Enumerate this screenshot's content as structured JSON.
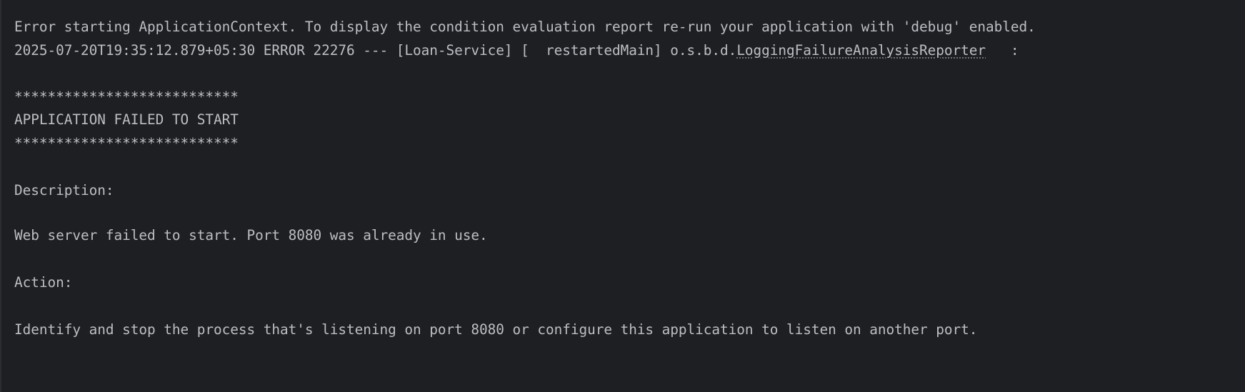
{
  "console": {
    "line1": "Error starting ApplicationContext. To display the condition evaluation report re-run your application with 'debug' enabled.",
    "line2_prefix": "2025-07-20T19:35:12.879+05:30 ERROR 22276 --- [Loan-Service] [  restartedMain] o.s.b.d.",
    "line2_link": "LoggingFailureAnalysisReporter",
    "line2_suffix": "   :",
    "stars_top": "***************************",
    "failed_title": "APPLICATION FAILED TO START",
    "stars_bottom": "***************************",
    "description_label": "Description:",
    "description_text": "Web server failed to start. Port 8080 was already in use.",
    "action_label": "Action:",
    "action_text": "Identify and stop the process that's listening on port 8080 or configure this application to listen on another port."
  },
  "colors": {
    "background": "#1e1f22",
    "text": "#bcbec4"
  }
}
